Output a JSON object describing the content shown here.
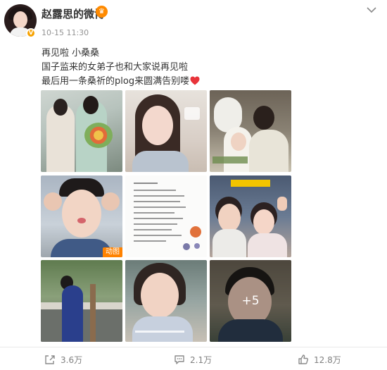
{
  "post": {
    "author": "赵露思的微博",
    "time": "10-15 11:30",
    "verified_badge": "V",
    "member_badge": "icon-member",
    "lines": [
      "再见啦 小桑桑",
      "国子监来的女弟子也和大家说再见啦",
      "最后用一条桑祈的plog来圆满告别喽"
    ],
    "images": [
      {
        "icon": "photo-1"
      },
      {
        "icon": "photo-2"
      },
      {
        "icon": "photo-3"
      },
      {
        "icon": "photo-4",
        "badge": "动图"
      },
      {
        "icon": "photo-5"
      },
      {
        "icon": "photo-6"
      },
      {
        "icon": "photo-7"
      },
      {
        "icon": "photo-8"
      },
      {
        "icon": "photo-9",
        "overlay": "+5"
      }
    ]
  },
  "actions": {
    "share_count": "3.6万",
    "comment_count": "2.1万",
    "like_count": "12.8万"
  },
  "colors": {
    "accent": "#ff8200",
    "heart": "#e8343a",
    "muted": "#939393"
  }
}
